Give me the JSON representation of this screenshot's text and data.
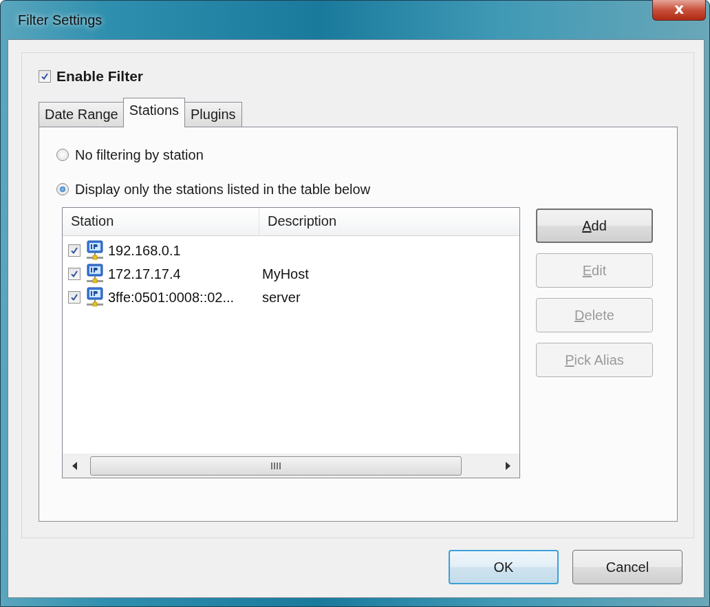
{
  "window": {
    "title": "Filter Settings",
    "close_label": "x"
  },
  "enable_filter": {
    "label": "Enable Filter",
    "checked": true
  },
  "tabs": [
    {
      "label": "Date Range",
      "selected": false
    },
    {
      "label": "Stations",
      "selected": true
    },
    {
      "label": "Plugins",
      "selected": false
    }
  ],
  "station_mode": [
    {
      "label": "No filtering by station",
      "selected": false
    },
    {
      "label": "Display only the stations listed in the table below",
      "selected": true
    }
  ],
  "table": {
    "columns": [
      "Station",
      "Description"
    ],
    "rows": [
      {
        "checked": true,
        "station": "192.168.0.1",
        "description": ""
      },
      {
        "checked": true,
        "station": "172.17.17.4",
        "description": "MyHost"
      },
      {
        "checked": true,
        "station": "3ffe:0501:0008::02...",
        "description": "server"
      }
    ]
  },
  "side_buttons": [
    {
      "access_key": "A",
      "label_rest": "dd",
      "disabled": false
    },
    {
      "access_key": "E",
      "label_rest": "dit",
      "disabled": true
    },
    {
      "access_key": "D",
      "label_rest": "elete",
      "disabled": true
    },
    {
      "access_key": "P",
      "label_rest": "ick Alias",
      "disabled": true
    }
  ],
  "dialog_buttons": [
    {
      "label": "OK",
      "default": true
    },
    {
      "label": "Cancel",
      "default": false
    }
  ]
}
